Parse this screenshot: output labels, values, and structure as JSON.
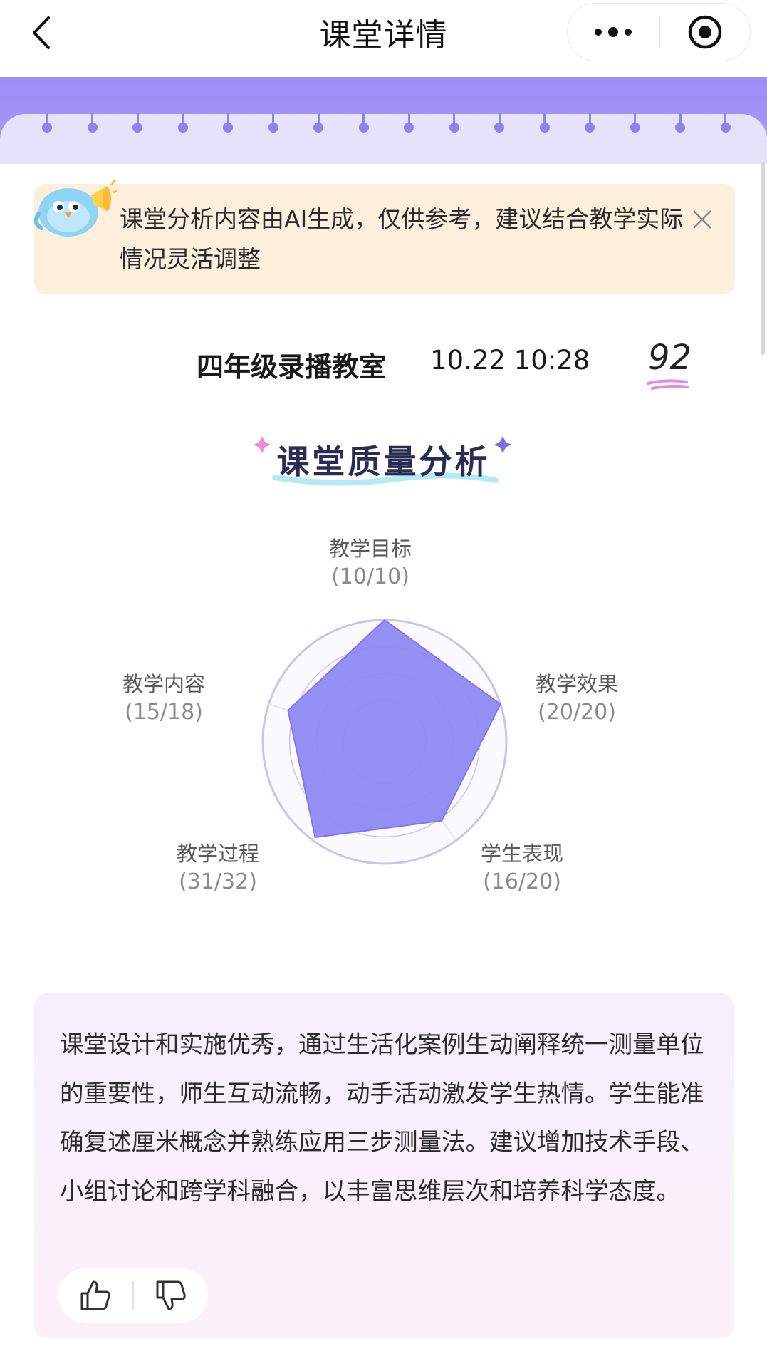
{
  "header": {
    "title": "课堂详情",
    "back_icon": "chevron-left-icon",
    "more_icon": "more-icon",
    "target_icon": "target-icon"
  },
  "notice": {
    "text": "课堂分析内容由AI生成，仅供参考，建议结合教学实际情况灵活调整",
    "close_icon": "close-icon",
    "mascot": "bird-mascot-icon"
  },
  "lesson": {
    "classroom": "四年级录播教室",
    "datetime": "10.22 10:28",
    "score": "92"
  },
  "section": {
    "title": "课堂质量分析"
  },
  "chart_data": {
    "type": "radar",
    "axes": [
      {
        "label": "教学目标",
        "value": 10,
        "max": 10,
        "display": "(10/10)"
      },
      {
        "label": "教学效果",
        "value": 20,
        "max": 20,
        "display": "(20/20)"
      },
      {
        "label": "学生表现",
        "value": 16,
        "max": 20,
        "display": "(16/20)"
      },
      {
        "label": "教学过程",
        "value": 31,
        "max": 32,
        "display": "(31/32)"
      },
      {
        "label": "教学内容",
        "value": 15,
        "max": 18,
        "display": "(15/18)"
      }
    ],
    "fill_color": "#8d86f2",
    "ring_color": "#c7c4f5"
  },
  "summary": {
    "text": "课堂设计和实施优秀，通过生活化案例生动阐释统一测量单位的重要性，师生互动流畅，动手活动激发学生热情。学生能准确复述厘米概念并熟练应用三步测量法。建议增加技术手段、小组讨论和跨学科融合，以丰富思维层次和培养科学态度。",
    "like_icon": "thumbs-up-icon",
    "dislike_icon": "thumbs-down-icon"
  },
  "colors": {
    "accent": "#9b8df5",
    "notice_bg": "#fdefdc"
  }
}
